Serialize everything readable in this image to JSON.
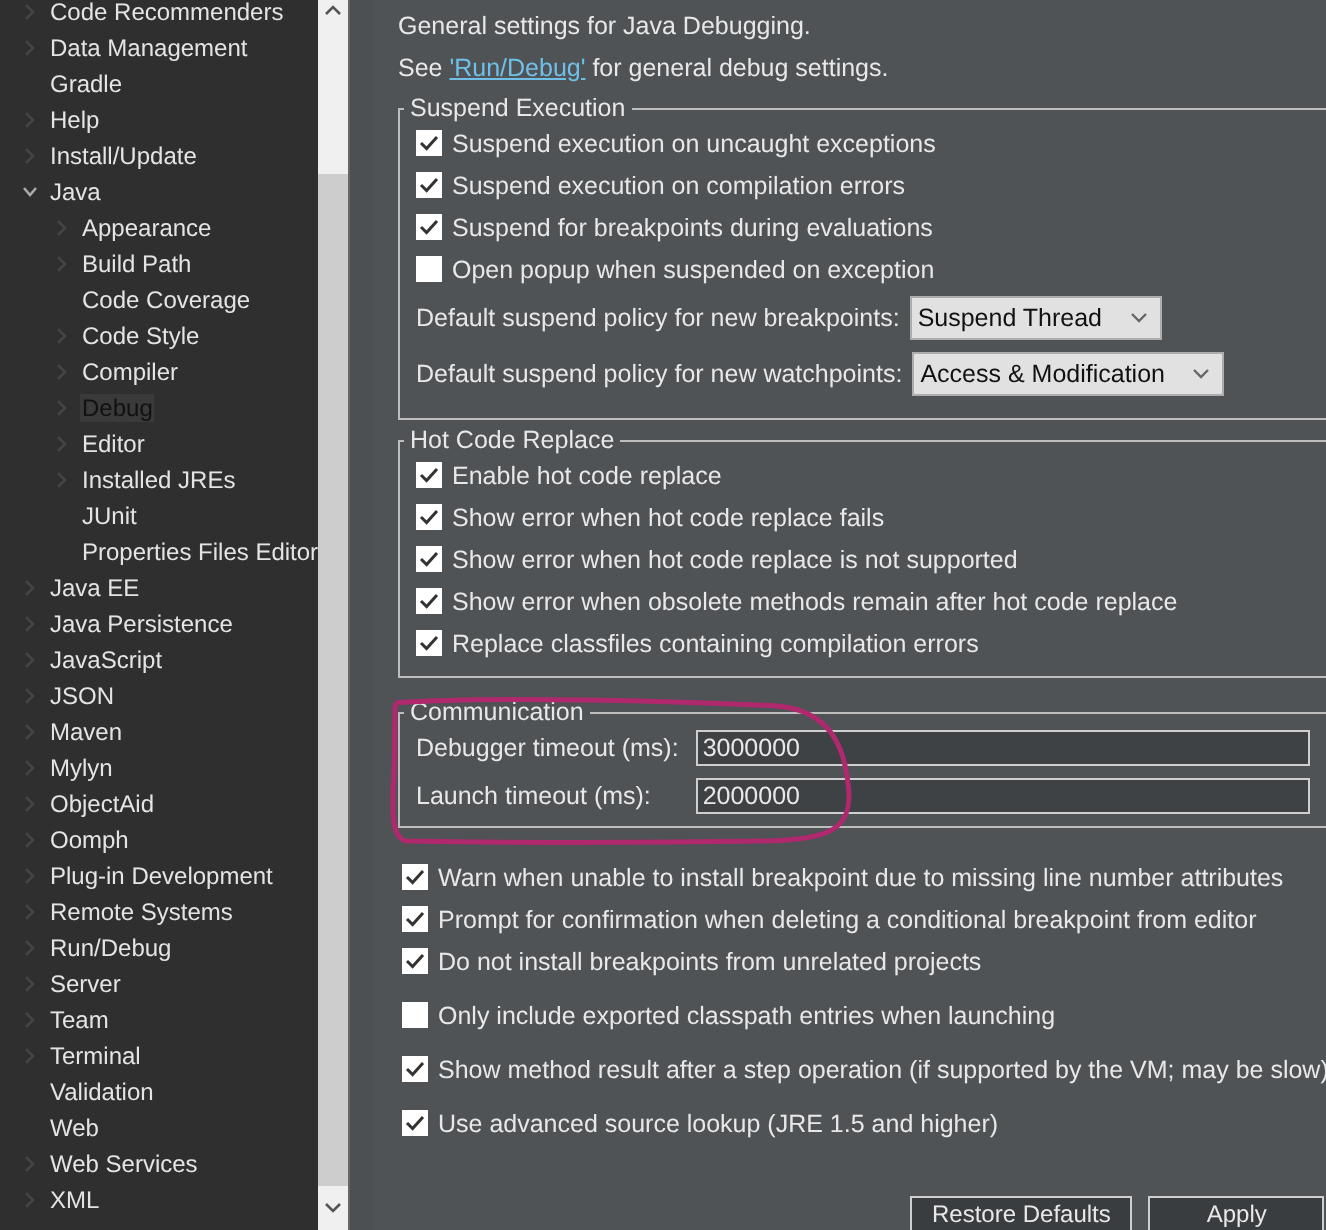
{
  "sidebar": {
    "items": [
      {
        "label": "Code Recommenders",
        "expandable": true,
        "selected": false
      },
      {
        "label": "Data Management",
        "expandable": true,
        "selected": false
      },
      {
        "label": "Gradle",
        "expandable": false,
        "selected": false
      },
      {
        "label": "Help",
        "expandable": true,
        "selected": false
      },
      {
        "label": "Install/Update",
        "expandable": true,
        "selected": false
      },
      {
        "label": "Java",
        "expandable": true,
        "expanded": true,
        "selected": false,
        "children": [
          {
            "label": "Appearance",
            "expandable": true,
            "selected": false
          },
          {
            "label": "Build Path",
            "expandable": true,
            "selected": false
          },
          {
            "label": "Code Coverage",
            "expandable": false,
            "selected": false
          },
          {
            "label": "Code Style",
            "expandable": true,
            "selected": false
          },
          {
            "label": "Compiler",
            "expandable": true,
            "selected": false
          },
          {
            "label": "Debug",
            "expandable": true,
            "selected": true
          },
          {
            "label": "Editor",
            "expandable": true,
            "selected": false
          },
          {
            "label": "Installed JREs",
            "expandable": true,
            "selected": false
          },
          {
            "label": "JUnit",
            "expandable": false,
            "selected": false
          },
          {
            "label": "Properties Files Editor",
            "expandable": false,
            "selected": false
          }
        ]
      },
      {
        "label": "Java EE",
        "expandable": true,
        "selected": false
      },
      {
        "label": "Java Persistence",
        "expandable": true,
        "selected": false
      },
      {
        "label": "JavaScript",
        "expandable": true,
        "selected": false
      },
      {
        "label": "JSON",
        "expandable": true,
        "selected": false
      },
      {
        "label": "Maven",
        "expandable": true,
        "selected": false
      },
      {
        "label": "Mylyn",
        "expandable": true,
        "selected": false
      },
      {
        "label": "ObjectAid",
        "expandable": true,
        "selected": false
      },
      {
        "label": "Oomph",
        "expandable": true,
        "selected": false
      },
      {
        "label": "Plug-in Development",
        "expandable": true,
        "selected": false
      },
      {
        "label": "Remote Systems",
        "expandable": true,
        "selected": false
      },
      {
        "label": "Run/Debug",
        "expandable": true,
        "selected": false
      },
      {
        "label": "Server",
        "expandable": true,
        "selected": false
      },
      {
        "label": "Team",
        "expandable": true,
        "selected": false
      },
      {
        "label": "Terminal",
        "expandable": true,
        "selected": false
      },
      {
        "label": "Validation",
        "expandable": false,
        "selected": false
      },
      {
        "label": "Web",
        "expandable": false,
        "selected": false
      },
      {
        "label": "Web Services",
        "expandable": true,
        "selected": false
      },
      {
        "label": "XML",
        "expandable": true,
        "selected": false
      }
    ]
  },
  "description": "General settings for Java Debugging.",
  "link_line": {
    "before": "See ",
    "link": "'Run/Debug'",
    "after": " for general debug settings."
  },
  "groups": [
    {
      "title": "Suspend Execution",
      "items": [
        {
          "kind": "checkbox",
          "label": "Suspend execution on uncaught exceptions",
          "checked": true
        },
        {
          "kind": "checkbox",
          "label": "Suspend execution on compilation errors",
          "checked": true
        },
        {
          "kind": "checkbox",
          "label": "Suspend for breakpoints during evaluations",
          "checked": true
        },
        {
          "kind": "checkbox",
          "label": "Open popup when suspended on exception",
          "checked": false
        },
        {
          "kind": "combo",
          "label": "Default suspend policy for new breakpoints:",
          "value": "Suspend Thread"
        },
        {
          "kind": "combo",
          "label": "Default suspend policy for new watchpoints:",
          "value": "Access & Modification"
        }
      ]
    },
    {
      "title": "Hot Code Replace",
      "items": [
        {
          "kind": "checkbox",
          "label": "Enable hot code replace",
          "checked": true
        },
        {
          "kind": "checkbox",
          "label": "Show error when hot code replace fails",
          "checked": true
        },
        {
          "kind": "checkbox",
          "label": "Show error when hot code replace is not supported",
          "checked": true
        },
        {
          "kind": "checkbox",
          "label": "Show error when obsolete methods remain after hot code replace",
          "checked": true
        },
        {
          "kind": "checkbox",
          "label": "Replace classfiles containing compilation errors",
          "checked": true
        }
      ]
    },
    {
      "title": "Communication",
      "items": [
        {
          "kind": "text",
          "label": "Debugger timeout (ms):",
          "value": "3000000"
        },
        {
          "kind": "text",
          "label": "Launch timeout (ms):",
          "value": "2000000"
        }
      ]
    }
  ],
  "option_sets": [
    [
      {
        "label": "Warn when unable to install breakpoint due to missing line number attributes",
        "checked": true
      },
      {
        "label": "Prompt for confirmation when deleting a conditional breakpoint from editor",
        "checked": true
      },
      {
        "label": "Do not install breakpoints from unrelated projects",
        "checked": true
      }
    ],
    [
      {
        "label": "Only include exported classpath entries when launching",
        "checked": false
      }
    ],
    [
      {
        "label": "Show method result after a step operation (if supported by the VM; may be slow)",
        "checked": true
      }
    ],
    [
      {
        "label": "Use advanced source lookup (JRE 1.5 and higher)",
        "checked": true
      }
    ]
  ],
  "buttons": [
    "Restore Defaults",
    "Apply"
  ]
}
